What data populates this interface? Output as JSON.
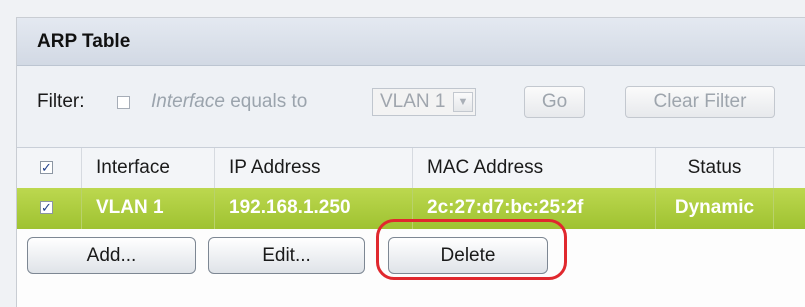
{
  "panel": {
    "title": "ARP Table"
  },
  "filter": {
    "label": "Filter:",
    "field_italic": "Interface",
    "condition": " equals to",
    "select_value": "VLAN 1",
    "go_label": "Go",
    "clear_label": "Clear Filter",
    "enabled": false
  },
  "table": {
    "columns": [
      "Interface",
      "IP Address",
      "MAC Address",
      "Status"
    ],
    "header_checkbox_checked": true,
    "rows": [
      {
        "checked": true,
        "interface": "VLAN 1",
        "ip": "192.168.1.250",
        "mac": "2c:27:d7:bc:25:2f",
        "status": "Dynamic"
      }
    ]
  },
  "actions": {
    "add_label": "Add...",
    "edit_label": "Edit...",
    "delete_label": "Delete"
  },
  "colors": {
    "selected_row": "#a8c83a",
    "highlight_ring": "#e0282e",
    "title_bar": "#dbe1ea"
  },
  "icons": {
    "dropdown": "chevron-down-icon",
    "checkmark": "checkmark-icon"
  }
}
